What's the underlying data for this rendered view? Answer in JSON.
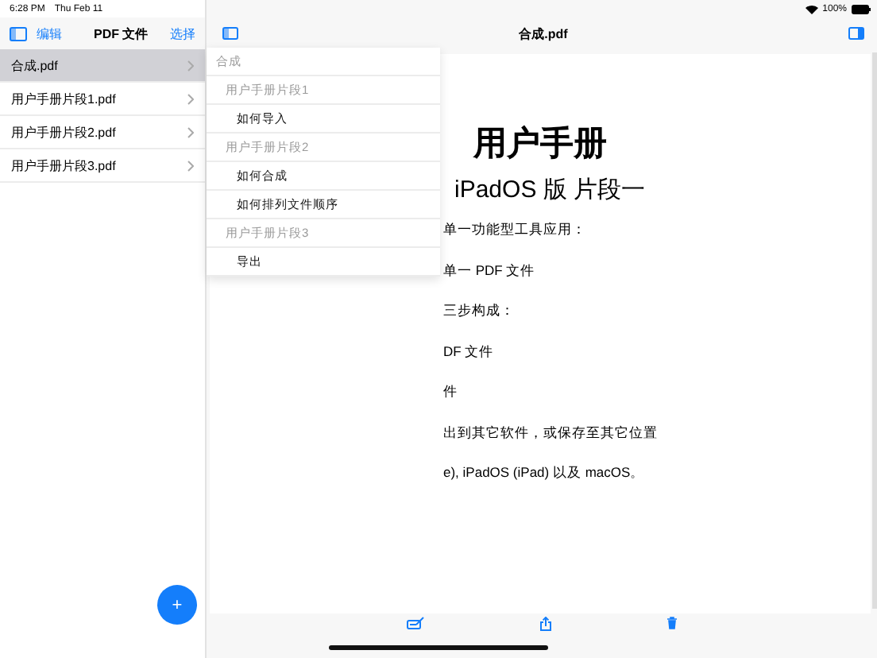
{
  "status_bar": {
    "time": "6:28 PM",
    "date": "Thu Feb 11",
    "battery": "100%"
  },
  "sidebar": {
    "edit_button": "编辑",
    "title": "PDF 文件",
    "select_button": "选择",
    "add_button": "+",
    "files": [
      {
        "name": "合成.pdf",
        "selected": true
      },
      {
        "name": "用户手册片段1.pdf",
        "selected": false
      },
      {
        "name": "用户手册片段2.pdf",
        "selected": false
      },
      {
        "name": "用户手册片段3.pdf",
        "selected": false
      }
    ]
  },
  "document": {
    "title": "合成.pdf",
    "outline": [
      {
        "kind": "root",
        "label": "合成"
      },
      {
        "kind": "header",
        "label": "用户手册片段1"
      },
      {
        "kind": "item",
        "label": "如何导入"
      },
      {
        "kind": "header",
        "label": "用户手册片段2"
      },
      {
        "kind": "item",
        "label": "如何合成"
      },
      {
        "kind": "item",
        "label": "如何排列文件顺序"
      },
      {
        "kind": "header",
        "label": "用户手册片段3"
      },
      {
        "kind": "item",
        "label": "导出"
      }
    ],
    "heading": "用户手册",
    "subheading": "iPadOS 版 片段一",
    "lines": [
      "单一功能型工具应用：",
      "单一 PDF 文件",
      "三步构成：",
      "DF 文件",
      "件",
      "出到其它软件，或保存至其它位置",
      "e), iPadOS (iPad) 以及 macOS。"
    ]
  }
}
